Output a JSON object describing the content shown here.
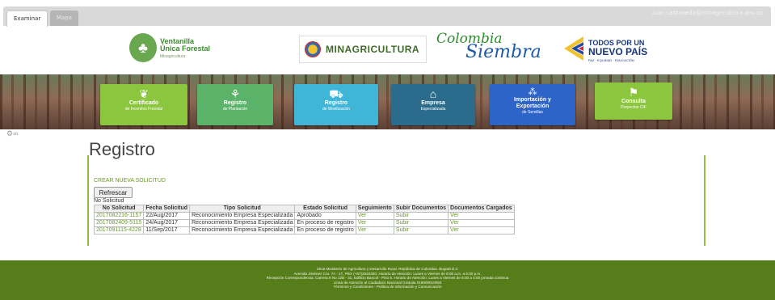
{
  "tabs": [
    {
      "label": "Examinar",
      "active": true
    },
    {
      "label": "Mapa",
      "active": false
    }
  ],
  "user_email": "juan.castaneda@minagricultura.gov.co",
  "logos": {
    "vuf_line1": "Ventanilla",
    "vuf_line2": "Única Forestal",
    "vuf_sub": "Minagricultura",
    "minagri": "MINAGRICULTURA",
    "colombia": "Colombia",
    "siembra": "Siembra",
    "tpnp_line1": "TODOS POR UN",
    "tpnp_line2": "NUEVO PAÍS",
    "tpnp_line3": "PAZ · EQUIDAD · EDUCACIÓN"
  },
  "tiles": [
    {
      "label": "Certificado",
      "sub": "de Incentivo Forestal",
      "icon": "seedling-icon",
      "color": "#8cc63f"
    },
    {
      "label": "Registro",
      "sub": "de Plantación",
      "icon": "plant-icon",
      "color": "#5bb36a"
    },
    {
      "label": "Registro",
      "sub": "de Movilización",
      "icon": "truck-icon",
      "color": "#3fb6d8"
    },
    {
      "label": "Empresa",
      "sub": "Especializada",
      "icon": "company-icon",
      "color": "#2b6c8c"
    },
    {
      "label": "Importación y",
      "sub": "Exportación",
      "sub2": "de Semillas",
      "icon": "seeds-icon",
      "color": "#2e63c7"
    },
    {
      "label": "Consulta",
      "sub": "Proyectos CIF",
      "icon": "presentation-icon",
      "color": "#8cc63f"
    }
  ],
  "page_title": "Registro",
  "create_link": "CREAR NUEVA SOLICITUD",
  "refresh_label": "Refrescar",
  "table_caption": "No Solicitud",
  "table": {
    "headers": [
      "No Solicitud",
      "Fecha Solicitud",
      "Tipo Solicitud",
      "Estado Solicitud",
      "Seguimiento",
      "Subir Documentos",
      "Documentos Cargados"
    ],
    "rows": [
      [
        "2017082216-1157",
        "22/Aug/2017",
        "Reconocimiento Empresa Especializada",
        "Aprobado",
        "Ver",
        "Subir",
        "Ver"
      ],
      [
        "2017082409-5115",
        "24/Aug/2017",
        "Reconocimiento Empresa Especializada",
        "En proceso de registro",
        "Ver",
        "Subir",
        "Ver"
      ],
      [
        "2017091115-4228",
        "11/Sep/2017",
        "Reconocimiento Empresa Especializada",
        "En proceso de registro",
        "Ver",
        "Subir",
        "Ver"
      ]
    ]
  },
  "footer": [
    "2015 Ministerio de Agricultura y Desarrollo Rural. República de Colombia. Bogotá D.C",
    "Avenida Jiménez Cra. 7A - 17, PBX (+57)2543300. Horario de Atención: Lunes a Viernes de 8:00 a.m. a 5:00 p.m.",
    "Recepción Correspondencia: Carrera 8 No 12B - 31, Edificio Bancol - Piso 5. Horario de Atención: Lunes a Viernes de 8:00 a 4:00 jornada continua",
    "Línea de Atención al Ciudadano Nacional Gratuita 018000510050",
    "Términos y Condiciones - Política de Información y Comunicación"
  ]
}
